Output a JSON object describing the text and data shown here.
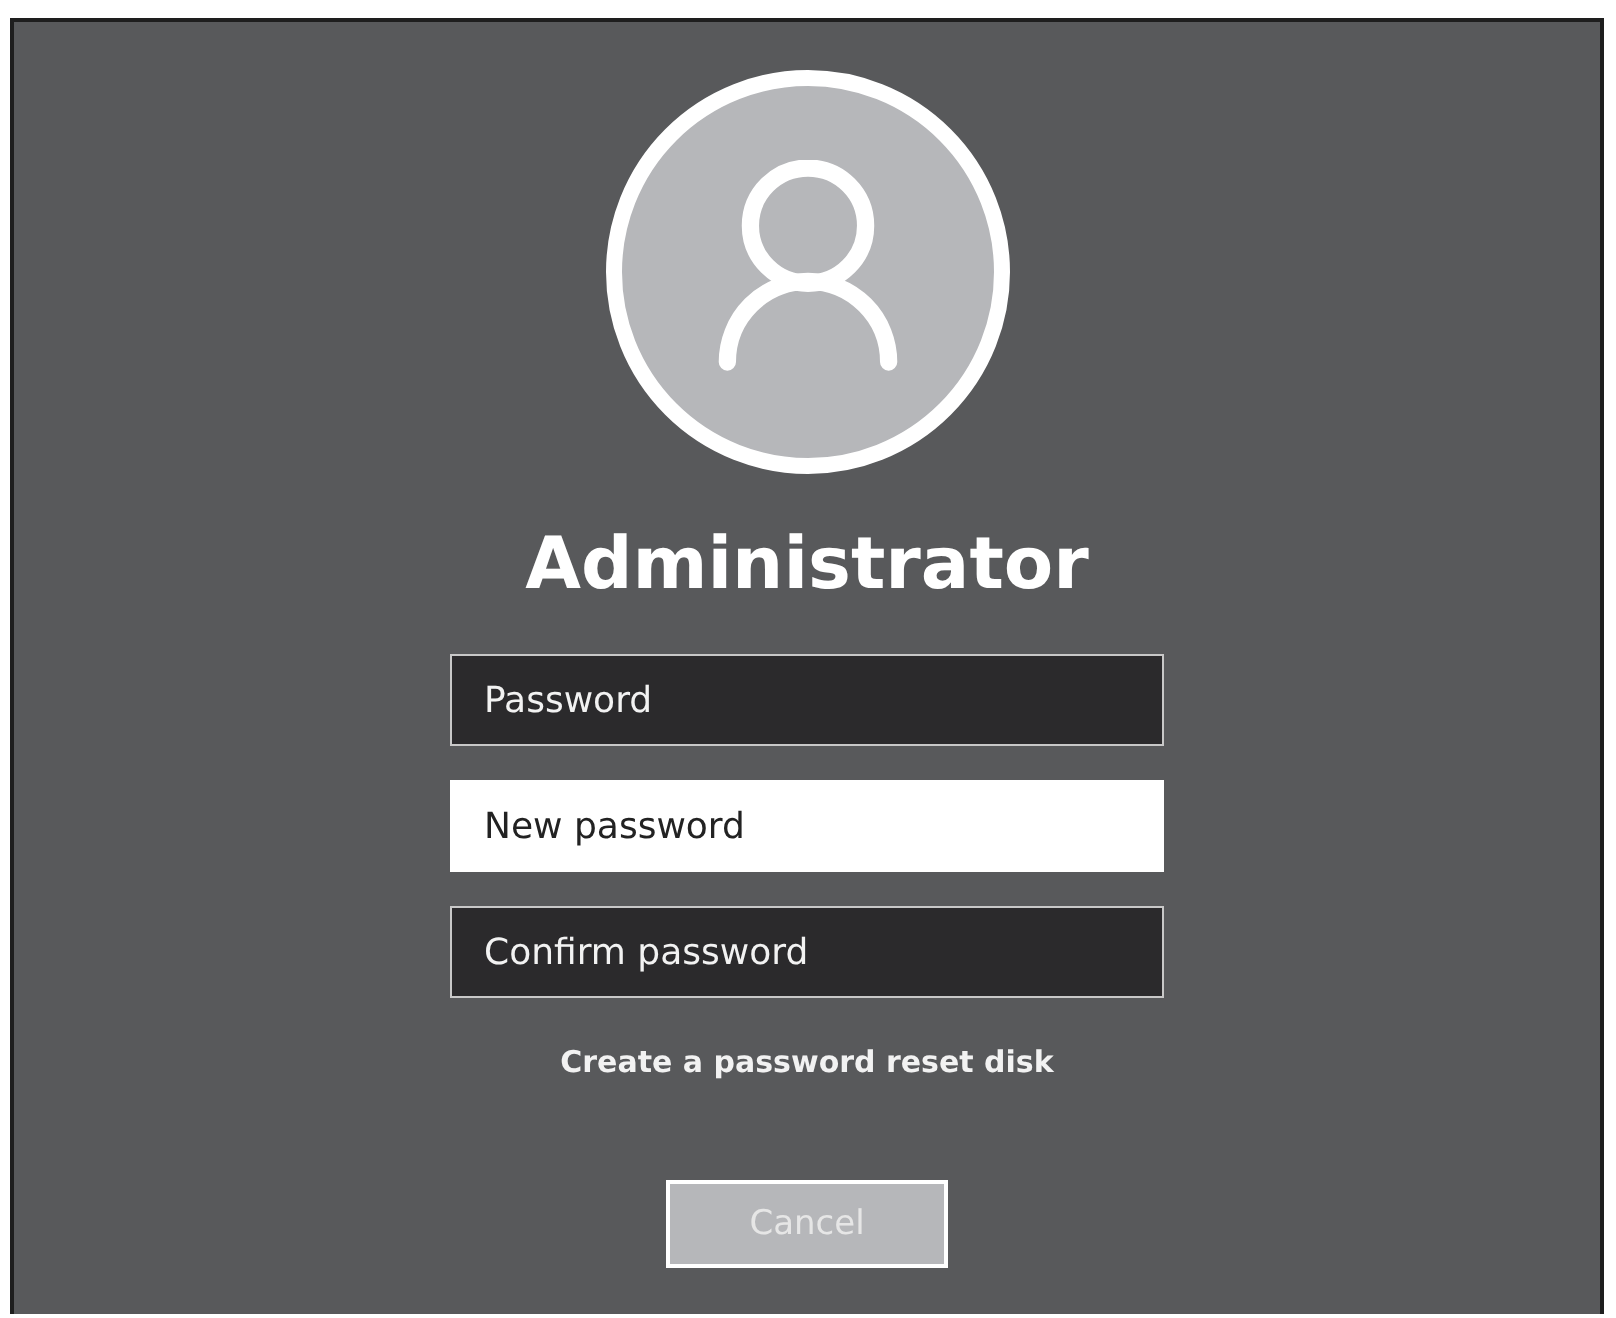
{
  "user": {
    "name": "Administrator"
  },
  "fields": [
    {
      "placeholder": "Password",
      "focused": false
    },
    {
      "placeholder": "New password",
      "focused": true
    },
    {
      "placeholder": "Confirm password",
      "focused": false
    }
  ],
  "reset_link": "Create a password reset disk",
  "cancel_button": {
    "label": "Cancel",
    "disabled": true
  }
}
